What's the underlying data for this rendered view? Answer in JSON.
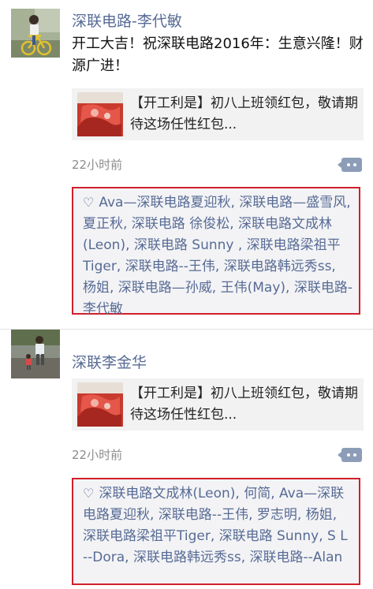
{
  "posts": [
    {
      "author": "深联电路-李代敏",
      "text": "开工大吉！祝深联电路2016年：生意兴隆！财源广进！",
      "link_title": "【开工利是】初八上班领红包，敬请期待这场任性红包...",
      "time": "22小时前",
      "likes": "Ava—深联电路夏迎秋, 深联电路—盛雪风, 夏正秋, 深联电路 徐俊松, 深联电路文成林(Leon), 深联电路 Sunny , 深联电路梁祖平Tiger, 深联电路--王伟, 深联电路韩远秀ss, 杨姐, 深联电路—孙威, 王伟(May), 深联电路-李代敏"
    },
    {
      "author": "深联李金华",
      "link_title": "【开工利是】初八上班领红包，敬请期待这场任性红包...",
      "time": "22小时前",
      "likes": "深联电路文成林(Leon), 何简, Ava—深联电路夏迎秋, 深联电路--王伟, 罗志明, 杨姐, 深联电路梁祖平Tiger, 深联电路 Sunny, S L --Dora, 深联电路韩远秀ss, 深联电路--Alan"
    }
  ],
  "icons": {
    "heart": "heart-outline-icon",
    "comment": "comment-dots-icon"
  },
  "colors": {
    "name_link": "#576b95",
    "highlight_border": "#d21f2b",
    "comment_button": "#8d9db8"
  }
}
